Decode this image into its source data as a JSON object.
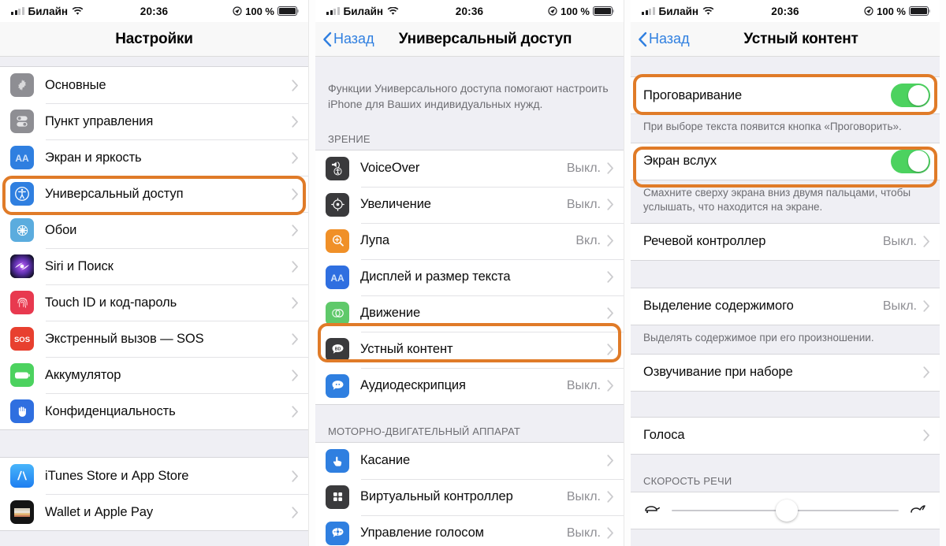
{
  "statusbar": {
    "carrier": "Билайн",
    "time": "20:36",
    "battery_pct": "100 %",
    "signal_icon": "cellular-bars-icon",
    "wifi_icon": "wifi-icon",
    "location_icon": "location-services-icon",
    "battery_icon": "battery-full-icon"
  },
  "accent": {
    "highlight": "#e07b28",
    "link_blue": "#2f7fe0",
    "toggle_green": "#4cd25f",
    "value_gray": "#8e8e93"
  },
  "panel1": {
    "nav_title": "Настройки",
    "groups": [
      {
        "rows": [
          {
            "label": "Основные",
            "icon": "gear-icon",
            "icon_color": "#8e8e93",
            "value": "",
            "chevron": true
          },
          {
            "label": "Пункт управления",
            "icon": "sliders-icon",
            "icon_color": "#8e8e93",
            "value": "",
            "chevron": true
          },
          {
            "label": "Экран и яркость",
            "icon": "aa-text-icon",
            "icon_color": "#2f7fe0",
            "value": "",
            "chevron": true
          },
          {
            "label": "Универсальный доступ",
            "icon": "accessibility-icon",
            "icon_color": "#2f7fe0",
            "value": "",
            "chevron": true,
            "highlighted": true
          },
          {
            "label": "Обои",
            "icon": "wallpaper-icon",
            "icon_color": "#5bacde",
            "value": "",
            "chevron": true
          },
          {
            "label": "Siri и Поиск",
            "icon": "siri-icon",
            "icon_color": "#1b1b2b",
            "value": "",
            "chevron": true
          },
          {
            "label": "Touch ID и код-пароль",
            "icon": "fingerprint-icon",
            "icon_color": "#e8394f",
            "value": "",
            "chevron": true
          },
          {
            "label": "Экстренный вызов — SOS",
            "icon": "sos-icon",
            "icon_color": "#e8402f",
            "value": "",
            "chevron": true
          },
          {
            "label": "Аккумулятор",
            "icon": "battery-icon",
            "icon_color": "#4cd25f",
            "value": "",
            "chevron": true
          },
          {
            "label": "Конфиденциальность",
            "icon": "hand-icon",
            "icon_color": "#2f6fe0",
            "value": "",
            "chevron": true
          }
        ]
      },
      {
        "rows": [
          {
            "label": "iTunes Store и App Store",
            "icon": "app-store-icon",
            "icon_color": "#3f9df5",
            "value": "",
            "chevron": true
          },
          {
            "label": "Wallet и Apple Pay",
            "icon": "wallet-icon",
            "icon_color": "#141414",
            "value": "",
            "chevron": true
          }
        ]
      }
    ]
  },
  "panel2": {
    "nav_back": "Назад",
    "nav_title": "Универсальный доступ",
    "intro": "Функции Универсального доступа помогают настроить iPhone для Ваших индивидуальных нужд.",
    "section1_header": "ЗРЕНИЕ",
    "section1_rows": [
      {
        "label": "VoiceOver",
        "icon": "voiceover-icon",
        "icon_color": "#3a3a3c",
        "value": "Выкл.",
        "chevron": true
      },
      {
        "label": "Увеличение",
        "icon": "zoom-icon",
        "icon_color": "#3a3a3c",
        "value": "Выкл.",
        "chevron": true
      },
      {
        "label": "Лупа",
        "icon": "magnifier-icon",
        "icon_color": "#f09028",
        "value": "Вкл.",
        "chevron": true
      },
      {
        "label": "Дисплей и размер текста",
        "icon": "aa-text-icon",
        "icon_color": "#2f6fe0",
        "value": "",
        "chevron": true
      },
      {
        "label": "Движение",
        "icon": "motion-icon",
        "icon_color": "#5fc96a",
        "value": "",
        "chevron": true
      },
      {
        "label": "Устный контент",
        "icon": "spoken-content-icon",
        "icon_color": "#3a3a3c",
        "value": "",
        "chevron": true,
        "highlighted": true
      },
      {
        "label": "Аудиодескрипция",
        "icon": "audio-desc-icon",
        "icon_color": "#2f7fe0",
        "value": "Выкл.",
        "chevron": true
      }
    ],
    "section2_header": "МОТОРНО-ДВИГАТЕЛЬНЫЙ АППАРАТ",
    "section2_rows": [
      {
        "label": "Касание",
        "icon": "touch-icon",
        "icon_color": "#2f7fe0",
        "value": "",
        "chevron": true
      },
      {
        "label": "Виртуальный контроллер",
        "icon": "switch-control-icon",
        "icon_color": "#3a3a3c",
        "value": "Выкл.",
        "chevron": true
      },
      {
        "label": "Управление голосом",
        "icon": "voice-control-icon",
        "icon_color": "#2f7fe0",
        "value": "Выкл.",
        "chevron": true
      }
    ]
  },
  "panel3": {
    "nav_back": "Назад",
    "nav_title": "Устный контент",
    "rows": [
      {
        "label": "Прогова­ривание",
        "type": "toggle",
        "value": "on",
        "highlighted": true
      },
      {
        "label": "Экран вслух",
        "type": "toggle",
        "value": "on",
        "highlighted": true
      },
      {
        "label": "Речевой контроллер",
        "type": "link",
        "value": "Выкл.",
        "chevron": true
      },
      {
        "label": "Выделение содержимого",
        "type": "link",
        "value": "Выкл.",
        "chevron": true
      },
      {
        "label": "Озвучивание при наборе",
        "type": "link",
        "value": "",
        "chevron": true
      },
      {
        "label": "Голоса",
        "type": "link",
        "value": "",
        "chevron": true
      }
    ],
    "footnote1": "При выборе текста появится кнопка «Проговорить».",
    "footnote2": "Смахните сверху экрана вниз двумя пальцами, чтобы услышать, что находится на экране.",
    "footnote3": "Выделять содержимое при его произношении.",
    "section_header": "СКОРОСТЬ РЕЧИ",
    "slider": {
      "left_icon": "tortoise-icon",
      "right_icon": "hare-icon",
      "position_pct": 46
    }
  }
}
